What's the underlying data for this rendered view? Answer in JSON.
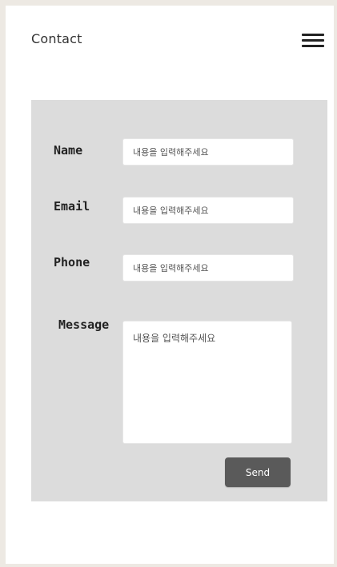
{
  "header": {
    "title": "Contact",
    "menu_icon": "hamburger-menu-icon"
  },
  "form": {
    "fields": [
      {
        "label": "Name",
        "placeholder": "내용을 입력해주세요",
        "value": ""
      },
      {
        "label": "Email",
        "placeholder": "내용을 입력해주세요",
        "value": ""
      },
      {
        "label": "Phone",
        "placeholder": "내용을 입력해주세요",
        "value": ""
      }
    ],
    "message": {
      "label": "Message",
      "placeholder": "내용을 입력해주세요",
      "value": ""
    },
    "send_label": "Send"
  },
  "colors": {
    "outer_background": "#ede9e3",
    "page_background": "#ffffff",
    "panel_background": "#dcdcdc",
    "button_background": "#5a5a5a",
    "button_text": "#ffffff"
  }
}
